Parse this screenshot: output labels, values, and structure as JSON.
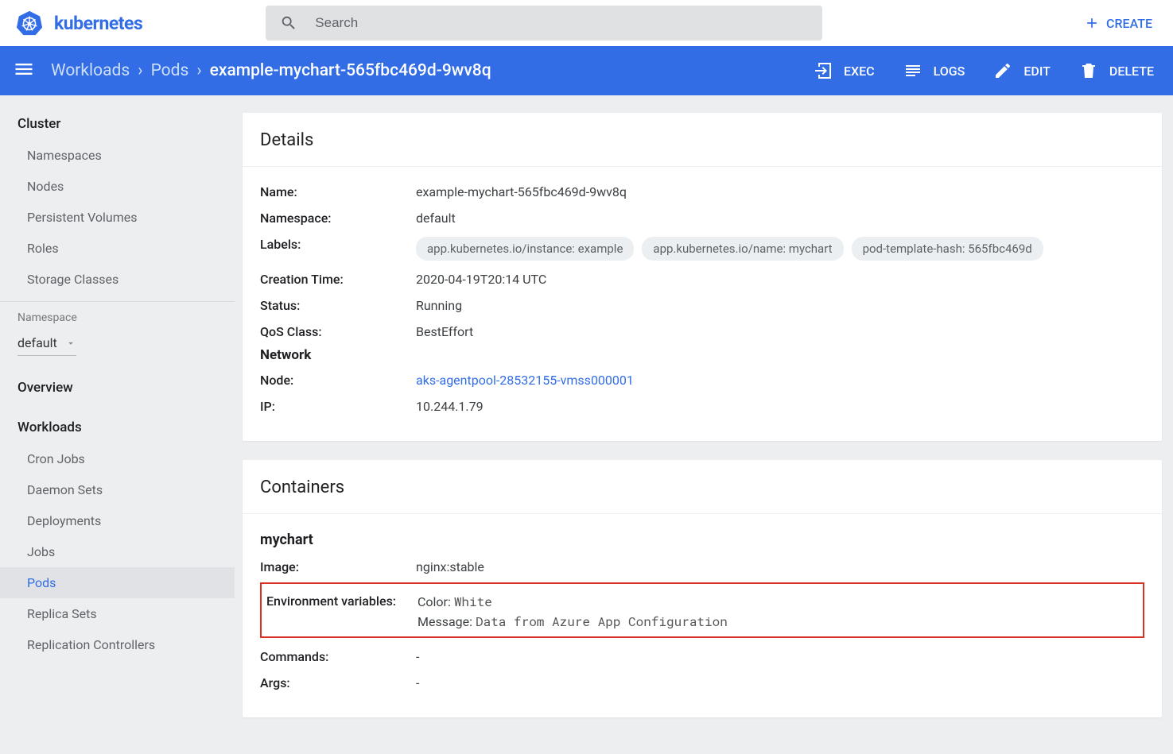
{
  "topbar": {
    "brand": "kubernetes",
    "search_placeholder": "Search",
    "create_label": "CREATE"
  },
  "breadcrumbs": {
    "items": [
      "Workloads",
      "Pods"
    ],
    "current": "example-mychart-565fbc469d-9wv8q"
  },
  "actions": {
    "exec": "EXEC",
    "logs": "LOGS",
    "edit": "EDIT",
    "delete": "DELETE"
  },
  "sidebar": {
    "cluster_header": "Cluster",
    "cluster_items": [
      "Namespaces",
      "Nodes",
      "Persistent Volumes",
      "Roles",
      "Storage Classes"
    ],
    "ns_label": "Namespace",
    "ns_selected": "default",
    "overview_header": "Overview",
    "workloads_header": "Workloads",
    "workloads_items": [
      "Cron Jobs",
      "Daemon Sets",
      "Deployments",
      "Jobs",
      "Pods",
      "Replica Sets",
      "Replication Controllers"
    ],
    "active_item": "Pods"
  },
  "details": {
    "title": "Details",
    "name_label": "Name:",
    "name_value": "example-mychart-565fbc469d-9wv8q",
    "namespace_label": "Namespace:",
    "namespace_value": "default",
    "labels_label": "Labels:",
    "labels": [
      "app.kubernetes.io/instance: example",
      "app.kubernetes.io/name: mychart",
      "pod-template-hash: 565fbc469d"
    ],
    "creation_label": "Creation Time:",
    "creation_value": "2020-04-19T20:14 UTC",
    "status_label": "Status:",
    "status_value": "Running",
    "qos_label": "QoS Class:",
    "qos_value": "BestEffort",
    "network_header": "Network",
    "node_label": "Node:",
    "node_value": "aks-agentpool-28532155-vmss000001",
    "ip_label": "IP:",
    "ip_value": "10.244.1.79"
  },
  "containers": {
    "title": "Containers",
    "name": "mychart",
    "image_label": "Image:",
    "image_value": "nginx:stable",
    "env_label": "Environment variables:",
    "env_vars": [
      {
        "key": "Color:",
        "value": "White"
      },
      {
        "key": "Message:",
        "value": "Data from Azure App Configuration"
      }
    ],
    "commands_label": "Commands:",
    "commands_value": "-",
    "args_label": "Args:",
    "args_value": "-"
  }
}
